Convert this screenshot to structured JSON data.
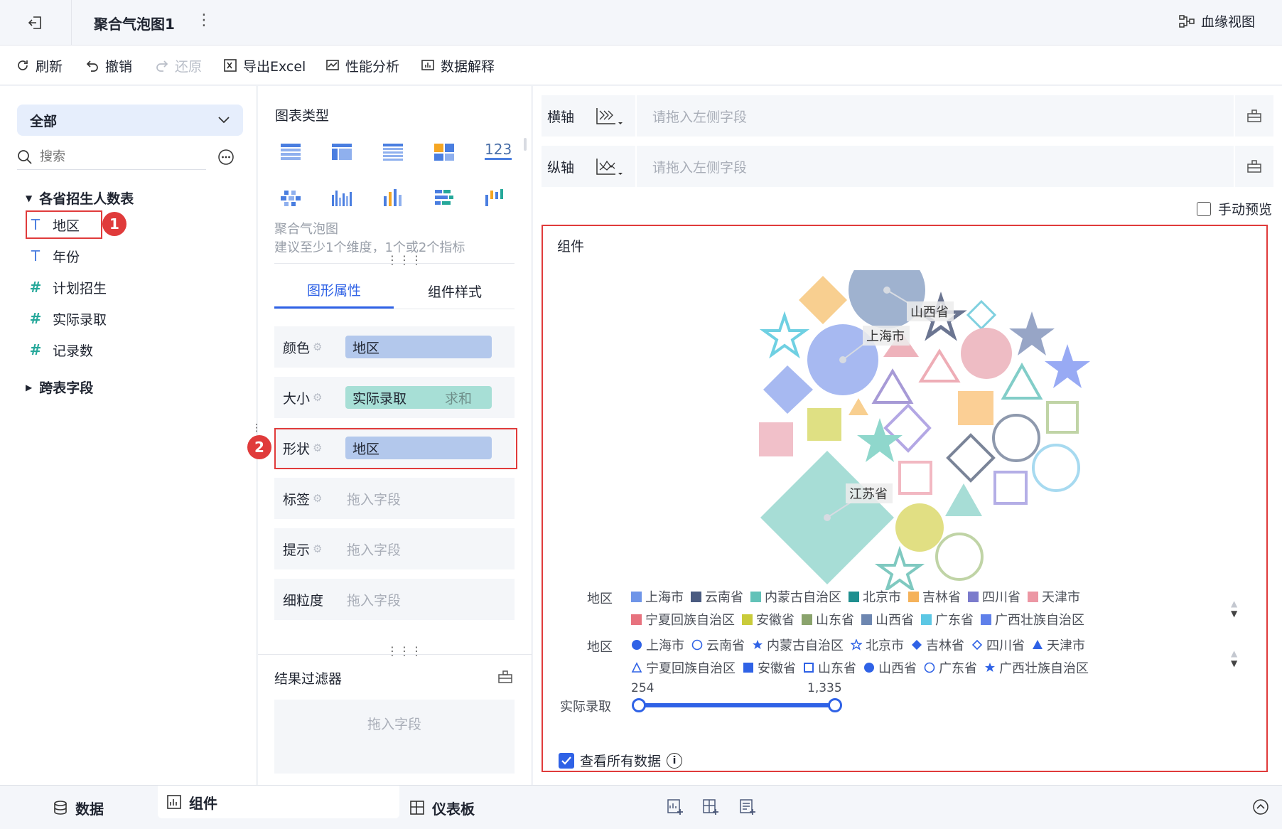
{
  "header": {
    "title": "聚合气泡图1",
    "lineage_label": "血缘视图"
  },
  "toolbar": {
    "refresh": "刷新",
    "undo": "撤销",
    "redo": "还原",
    "export": "导出Excel",
    "perf": "性能分析",
    "explain": "数据解释"
  },
  "left": {
    "dropdown_value": "全部",
    "search_placeholder": "搜索",
    "table_name": "各省招生人数表",
    "fields": [
      {
        "label": "地区",
        "kind": "dimension"
      },
      {
        "label": "年份",
        "kind": "dimension"
      },
      {
        "label": "计划招生",
        "kind": "measure"
      },
      {
        "label": "实际录取",
        "kind": "measure"
      },
      {
        "label": "记录数",
        "kind": "measure"
      }
    ],
    "cross_table": "跨表字段",
    "badge_1": "1"
  },
  "mid": {
    "chart_type_title": "图表类型",
    "chart_name": "聚合气泡图",
    "chart_hint": "建议至少1个维度，1个或2个指标",
    "tab_props": "图形属性",
    "tab_style": "组件样式",
    "props": [
      {
        "label": "颜色",
        "value": "地区",
        "agg": ""
      },
      {
        "label": "大小",
        "value": "实际录取",
        "agg": "求和"
      },
      {
        "label": "形状",
        "value": "地区",
        "agg": ""
      },
      {
        "label": "标签",
        "value": "",
        "agg": "",
        "placeholder": "拖入字段"
      },
      {
        "label": "提示",
        "value": "",
        "agg": "",
        "placeholder": "拖入字段"
      },
      {
        "label": "细粒度",
        "value": "",
        "agg": "",
        "placeholder": "拖入字段"
      }
    ],
    "badge_2": "2",
    "filter_title": "结果过滤器",
    "filter_placeholder": "拖入字段",
    "number_icon_text": "123"
  },
  "right": {
    "x_axis_label": "横轴",
    "y_axis_label": "纵轴",
    "axis_placeholder": "请拖入左侧字段",
    "manual_preview": "手动预览",
    "component_title": "组件",
    "show_all_data": "查看所有数据"
  },
  "chart_data": {
    "type": "bubble",
    "bubble_labels": [
      "山西省",
      "上海市",
      "江苏省"
    ],
    "legend_color_title": "地区",
    "legend_shape_title": "地区",
    "legend_size_title": "实际录取",
    "legend_regions": [
      "上海市",
      "云南省",
      "内蒙古自治区",
      "北京市",
      "吉林省",
      "四川省",
      "天津市",
      "宁夏回族自治区",
      "安徽省",
      "山东省",
      "山西省",
      "广东省",
      "广西壮族自治区"
    ],
    "legend_colors": [
      "#6f95e8",
      "#4a5b80",
      "#62c2b8",
      "#1f8f8f",
      "#f5b25a",
      "#7b7bcc",
      "#ec97a4",
      "#e7727e",
      "#c9cb3a",
      "#8aa36c",
      "#6d86b0",
      "#5cc7e4",
      "#5f80ea"
    ],
    "legend_shapes": [
      "circle-filled",
      "circle-hollow",
      "star-filled",
      "star-hollow",
      "diamond-filled",
      "diamond-hollow",
      "triangle-filled",
      "triangle-hollow",
      "square-filled",
      "square-hollow",
      "circle-filled",
      "circle-hollow",
      "star-filled"
    ],
    "size_range": [
      "254",
      "1,335"
    ]
  },
  "bottom": {
    "data_tab": "数据",
    "component_tab": "组件",
    "dashboard_tab": "仪表板"
  },
  "colors": {
    "accent": "#2f62e6",
    "highlight_red": "#e03b3b",
    "pill_blue": "#b3c8ec",
    "pill_teal": "#a7dfd6"
  }
}
